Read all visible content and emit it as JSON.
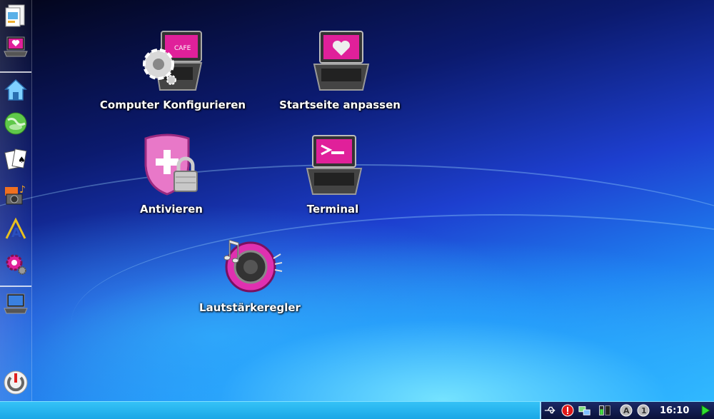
{
  "desktop": {
    "icons": [
      {
        "label": "Computer Konfigurieren",
        "icon": "gear-laptop-icon"
      },
      {
        "label": "Startseite anpassen",
        "icon": "heart-laptop-icon"
      },
      {
        "label": "Antivieren",
        "icon": "shield-lock-icon"
      },
      {
        "label": "Terminal",
        "icon": "terminal-laptop-icon"
      },
      {
        "label": "Lautstärkeregler",
        "icon": "speaker-icon"
      }
    ]
  },
  "sidebar": {
    "items": [
      "file-manager-icon",
      "laptop-heart-icon",
      "home-icon",
      "globe-icon",
      "cards-icon",
      "media-icon",
      "office-icon",
      "settings-icon",
      "laptop-icon",
      "power-icon"
    ]
  },
  "taskbar": {
    "clock": "16:10",
    "tray": [
      "usb-icon",
      "alert-icon",
      "network-icon",
      "battery-icon",
      "keyboard-a-icon",
      "keyboard-1-icon",
      "arrow-icon"
    ]
  },
  "colors": {
    "accent_pink": "#e0209a",
    "taskbar": "#1aa7e6",
    "tray_bg": "#0b123a"
  }
}
